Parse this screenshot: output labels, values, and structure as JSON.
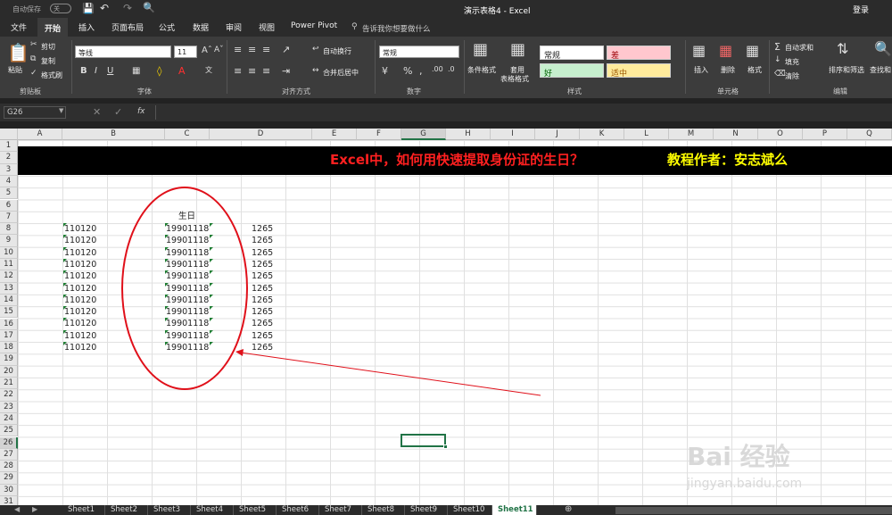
{
  "titlebar": {
    "autosave": "自动保存",
    "autosave_state": "关",
    "title": "演示表格4  -  Excel",
    "login": "登录"
  },
  "tabs": [
    "文件",
    "开始",
    "插入",
    "页面布局",
    "公式",
    "数据",
    "审阅",
    "视图",
    "Power Pivot"
  ],
  "tell_me": "告诉我你想要做什么",
  "ribbon": {
    "paste": "粘贴",
    "cut": "剪切",
    "copy": "复制",
    "format_painter": "格式刷",
    "font_name": "等线",
    "font_size": "11",
    "wrap_text": "自动换行",
    "merge_center": "合并后居中",
    "number_format": "常规",
    "cond_format": "条件格式",
    "table_format": "套用\n表格格式",
    "style_normal": "常规",
    "style_bad": "差",
    "style_good": "好",
    "style_neutral": "适中",
    "insert": "插入",
    "delete": "删除",
    "format": "格式",
    "autosum": "自动求和",
    "fill": "填充",
    "clear": "清除",
    "sort_filter": "排序和筛选",
    "find_select": "查找和",
    "groups": [
      "剪贴板",
      "字体",
      "对齐方式",
      "数字",
      "样式",
      "单元格",
      "编辑"
    ]
  },
  "formula_bar": {
    "name_box": "G26",
    "fx": "fx",
    "value": ""
  },
  "columns": [
    "A",
    "B",
    "C",
    "D",
    "E",
    "F",
    "G",
    "H",
    "I",
    "J",
    "K",
    "L",
    "M",
    "N",
    "O",
    "P",
    "Q"
  ],
  "rows": [
    "1",
    "2",
    "3",
    "4",
    "5",
    "6",
    "7",
    "8",
    "9",
    "10",
    "11",
    "12",
    "13",
    "14",
    "15",
    "16",
    "17",
    "18",
    "19",
    "20",
    "21",
    "22",
    "23",
    "24",
    "25",
    "26",
    "27",
    "28",
    "29",
    "30",
    "31"
  ],
  "banner": {
    "title": "Excel中，如何用快速提取身份证的生日？",
    "author": "教程作者：安志斌么"
  },
  "header_c7": "生日",
  "data_rows": [
    {
      "b": "110120",
      "c": "19901118",
      "d": "1265"
    },
    {
      "b": "110120",
      "c": "19901118",
      "d": "1265"
    },
    {
      "b": "110120",
      "c": "19901118",
      "d": "1265"
    },
    {
      "b": "110120",
      "c": "19901118",
      "d": "1265"
    },
    {
      "b": "110120",
      "c": "19901118",
      "d": "1265"
    },
    {
      "b": "110120",
      "c": "19901118",
      "d": "1265"
    },
    {
      "b": "110120",
      "c": "19901118",
      "d": "1265"
    },
    {
      "b": "110120",
      "c": "19901118",
      "d": "1265"
    },
    {
      "b": "110120",
      "c": "19901118",
      "d": "1265"
    },
    {
      "b": "110120",
      "c": "19901118",
      "d": "1265"
    },
    {
      "b": "110120",
      "c": "19901118",
      "d": "1265"
    }
  ],
  "sheets": [
    "Sheet1",
    "Sheet2",
    "Sheet3",
    "Sheet4",
    "Sheet5",
    "Sheet6",
    "Sheet7",
    "Sheet8",
    "Sheet9",
    "Sheet10",
    "Sheet11"
  ],
  "active_sheet": "Sheet11",
  "watermark": {
    "brand": "Bai 经验",
    "url": "jingyan.baidu.com"
  },
  "colors": {
    "accent": "#217346",
    "annotation": "#e0101a",
    "banner_title": "#ff2020",
    "banner_author": "#ffff00"
  }
}
